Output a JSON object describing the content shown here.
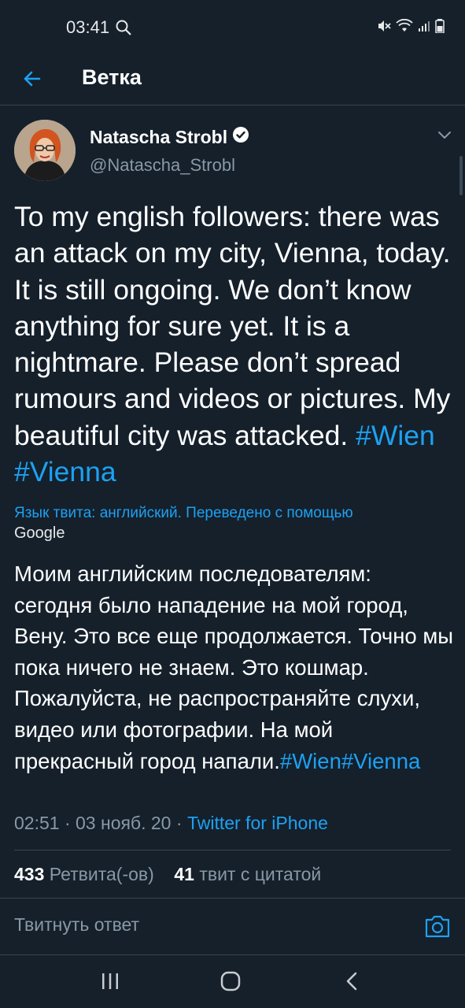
{
  "status_bar": {
    "time": "03:41",
    "icons": [
      "search-icon",
      "mute-icon",
      "wifi-icon",
      "signal-icon",
      "battery-icon"
    ]
  },
  "app_bar": {
    "title": "Ветка",
    "back_icon": "back-arrow-icon"
  },
  "tweet": {
    "author_name": "Natascha Strobl",
    "verified": true,
    "handle": "@Natascha_Strobl",
    "text": "To my english followers: there was an attack on my city, Vienna, today. It is still ongoing. We don’t know anything for sure yet. It is a nightmare. Please don’t spread rumours and videos or pictures. My beautiful city was attacked.",
    "hashtags": [
      "#Wien",
      "#Vienna"
    ],
    "translation_note": "Язык твита: английский. Переведено с помощью",
    "translation_provider": "Google",
    "translated_text": "Моим английским последователям: сегодня было нападение на мой город, Вену. Это все еще продолжается. Точно мы пока ничего не знаем. Это кошмар. Пожалуйста, не распространяйте слухи, видео или фотографии. На мой прекрасный город напали.",
    "translated_hashtags": "#Wien#Vienna",
    "time": "02:51",
    "date": "03 нояб. 20",
    "separator": "·",
    "source": "Twitter for iPhone",
    "retweets_count": "433",
    "retweets_label": "Ретвита(-ов)",
    "quotes_count": "41",
    "quotes_label": "твит с цитатой"
  },
  "reply": {
    "placeholder": "Твитнуть ответ",
    "camera_icon": "camera-icon"
  },
  "colors": {
    "background": "#15202b",
    "accent": "#1da1f2",
    "secondary_text": "#8899a6",
    "divider": "#38444d"
  }
}
